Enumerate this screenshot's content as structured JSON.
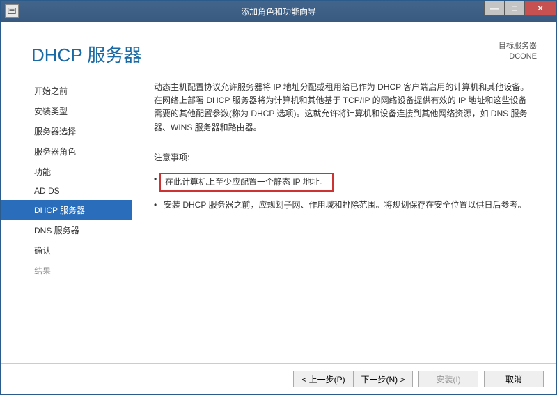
{
  "titlebar": {
    "title": "添加角色和功能向导"
  },
  "header": {
    "page_title": "DHCP 服务器",
    "target_label": "目标服务器",
    "target_value": "DCONE"
  },
  "sidebar": {
    "items": [
      {
        "label": "开始之前",
        "active": false,
        "disabled": false
      },
      {
        "label": "安装类型",
        "active": false,
        "disabled": false
      },
      {
        "label": "服务器选择",
        "active": false,
        "disabled": false
      },
      {
        "label": "服务器角色",
        "active": false,
        "disabled": false
      },
      {
        "label": "功能",
        "active": false,
        "disabled": false
      },
      {
        "label": "AD DS",
        "active": false,
        "disabled": false
      },
      {
        "label": "DHCP 服务器",
        "active": true,
        "disabled": false
      },
      {
        "label": "DNS 服务器",
        "active": false,
        "disabled": false
      },
      {
        "label": "确认",
        "active": false,
        "disabled": false
      },
      {
        "label": "结果",
        "active": false,
        "disabled": true
      }
    ]
  },
  "main": {
    "description": "动态主机配置协议允许服务器将 IP 地址分配或租用给已作为 DHCP 客户端启用的计算机和其他设备。在网络上部署 DHCP 服务器将为计算机和其他基于 TCP/IP 的网络设备提供有效的 IP 地址和这些设备需要的其他配置参数(称为 DHCP 选项)。这就允许将计算机和设备连接到其他网络资源，如 DNS 服务器、WINS 服务器和路由器。",
    "notice_label": "注意事项:",
    "bullets": [
      {
        "text": "在此计算机上至少应配置一个静态 IP 地址。",
        "highlight": true
      },
      {
        "text": "安装 DHCP 服务器之前，应规划子网、作用域和排除范围。将规划保存在安全位置以供日后参考。",
        "highlight": false
      }
    ]
  },
  "footer": {
    "prev": "< 上一步(P)",
    "next": "下一步(N) >",
    "install": "安装(I)",
    "cancel": "取消"
  }
}
